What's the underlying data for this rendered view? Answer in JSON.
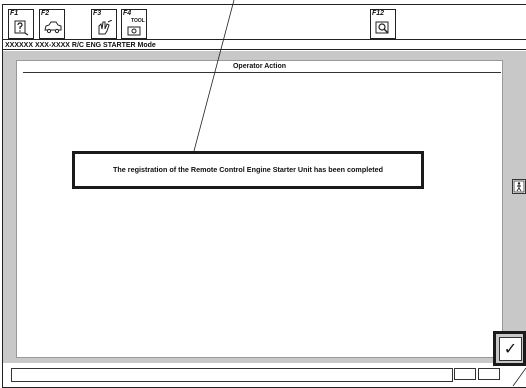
{
  "toolbar": {
    "keys": [
      {
        "label": "F1",
        "icon": "help-icon"
      },
      {
        "label": "F2",
        "icon": "car-icon"
      },
      {
        "label": "F3",
        "icon": "hand-icon"
      },
      {
        "label": "F4",
        "label2": "TOOL",
        "icon": "tool-icon"
      },
      {
        "label": "F12",
        "icon": "search-icon"
      }
    ]
  },
  "mode_bar": {
    "text": "XXXXXX XXX-XXXX R/C ENG STARTER Mode"
  },
  "panel": {
    "title": "Operator Action",
    "message": "The registration of the Remote Control Engine Starter Unit has been completed"
  },
  "ok_button": {
    "glyph": "✓"
  },
  "side_button": {
    "icon": "person-exit-icon"
  }
}
